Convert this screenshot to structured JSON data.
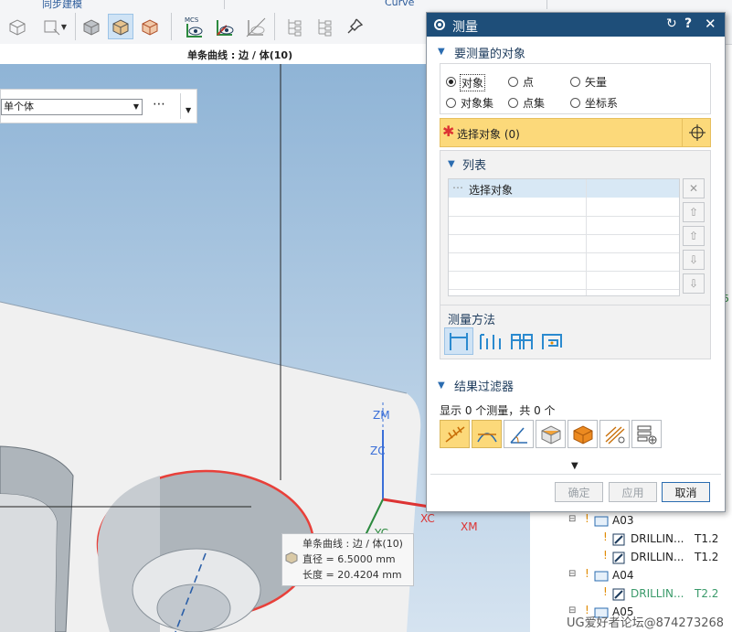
{
  "ribbon": {
    "group_sync": "同步建模",
    "group_curve": "Curve",
    "mcs_label": "MCS"
  },
  "status": {
    "text": "单条曲线 : 边 / 体(10)"
  },
  "selection_filter": {
    "value": "单个体",
    "more": "⋯"
  },
  "viewport": {
    "axis_zm": "ZM",
    "axis_zc": "ZC",
    "axis_yc": "YC",
    "axis_xc": "XC",
    "axis_xm": "XM"
  },
  "tooltip": {
    "line1": "单条曲线 : 边 / 体(10)",
    "line2": "直径 = 6.5000 mm",
    "line3": "长度 = 20.4204 mm"
  },
  "tree": {
    "rows": [
      {
        "name": "A03",
        "tool": ""
      },
      {
        "name": "DRILLIN...",
        "tool": "T1.2"
      },
      {
        "name": "DRILLIN...",
        "tool": "T1.2"
      },
      {
        "name": "A04",
        "tool": ""
      },
      {
        "name": "DRILLIN...",
        "tool": "T2.2"
      },
      {
        "name": "A05",
        "tool": ""
      }
    ],
    "edge_digit": "5",
    "watermark": "UG爱好者论坛@874273268"
  },
  "dialog": {
    "title": "测量",
    "section_objects": "要测量的对象",
    "radios": {
      "object": "对象",
      "point": "点",
      "vector": "矢量",
      "object_set": "对象集",
      "point_set": "点集",
      "csys": "坐标系"
    },
    "select_object": "选择对象 (0)",
    "list_title": "列表",
    "list_first_row": "选择对象",
    "method_title": "测量方法",
    "section_filter": "结果过滤器",
    "filter_summary": "显示 0 个测量，共 0 个",
    "buttons": {
      "ok": "确定",
      "apply": "应用",
      "cancel": "取消"
    }
  },
  "colors": {
    "title_bar": "#1e4e79",
    "selection_highlight": "#fcd97a",
    "viewport_top": "#8fb4d6",
    "edge_highlight": "#e8403a"
  }
}
